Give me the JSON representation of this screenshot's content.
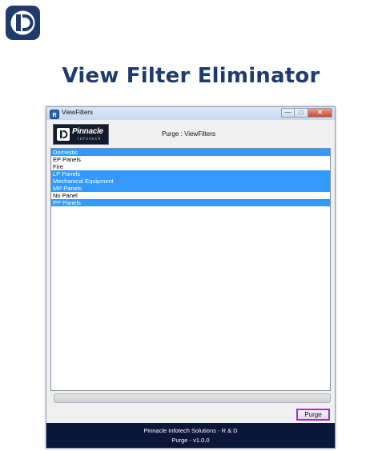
{
  "brand": {
    "logo_icon": "pinnacle-d-logo-icon",
    "color": "#1f3b6e"
  },
  "hero": {
    "title": "View Filter Eliminator"
  },
  "window": {
    "title": "ViewFilters",
    "app_icon": "revit-app-icon",
    "controls": {
      "minimize": "—",
      "maximize": "□",
      "close": "✕"
    }
  },
  "header": {
    "company_name": "Pinnacle",
    "company_sub": "Infotech",
    "caption": "Purge : ViewFilters"
  },
  "view_filters": [
    {
      "label": "Domestic",
      "selected": true
    },
    {
      "label": "EP Panels",
      "selected": false
    },
    {
      "label": "Fire",
      "selected": false
    },
    {
      "label": "LP Panels",
      "selected": true
    },
    {
      "label": "Mechanical Equipment",
      "selected": true
    },
    {
      "label": "MP Panels",
      "selected": true
    },
    {
      "label": "No Panel",
      "selected": false
    },
    {
      "label": "PP Panels",
      "selected": true
    }
  ],
  "progress": {
    "value": 0
  },
  "actions": {
    "purge_label": "Purge"
  },
  "footer": {
    "line1": "Pinnacle Infotech Solutions - R & D",
    "line2": "Purge - v1.0.0"
  },
  "colors": {
    "selection": "#3399ff",
    "footer_bg": "#0b1638",
    "purge_highlight": "#9b34c9"
  }
}
